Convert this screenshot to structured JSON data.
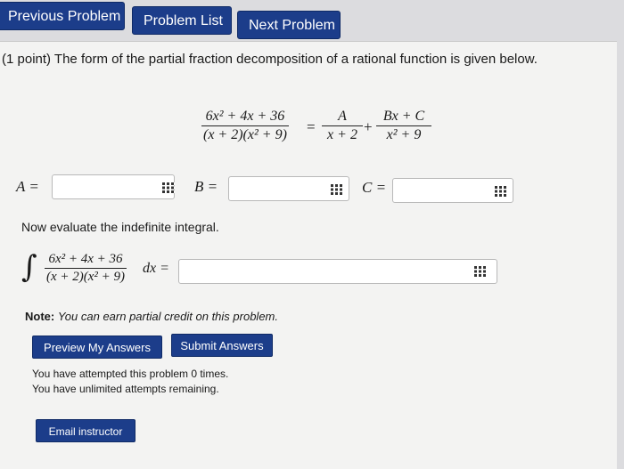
{
  "nav": {
    "previous_label": "Previous Problem",
    "list_label": "Problem List",
    "next_label": "Next Problem"
  },
  "problem": {
    "intro": "(1 point) The form of the partial fraction decomposition of a rational function is given below.",
    "lhs_numerator": "6x² + 4x + 36",
    "lhs_denominator": "(x + 2)(x² + 9)",
    "equals": "=",
    "term1_numerator": "A",
    "term1_denominator": "x + 2",
    "plus": "+",
    "term2_numerator": "Bx + C",
    "term2_denominator": "x² + 9",
    "label_a": "A =",
    "label_b": "B =",
    "label_c": "C =",
    "integral_prompt": "Now evaluate the indefinite integral.",
    "integral_sign": "∫",
    "integral_numerator": "6x² + 4x + 36",
    "integral_denominator": "(x + 2)(x² + 9)",
    "integral_tail": "dx ="
  },
  "answers": {
    "a_value": "",
    "b_value": "",
    "c_value": "",
    "integral_value": ""
  },
  "note": {
    "label": "Note:",
    "text": "You can earn partial credit on this problem."
  },
  "buttons": {
    "preview_label": "Preview My Answers",
    "submit_label": "Submit Answers",
    "email_label": "Email instructor"
  },
  "attempts": {
    "line1": "You have attempted this problem 0 times.",
    "line2": "You have unlimited attempts remaining."
  }
}
